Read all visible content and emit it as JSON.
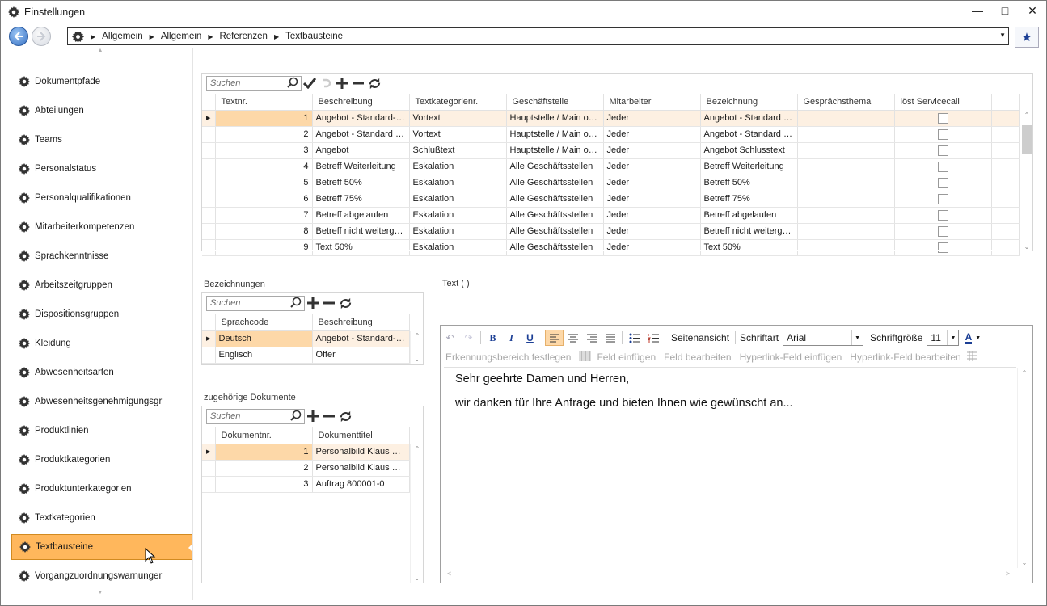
{
  "window": {
    "title": "Einstellungen"
  },
  "breadcrumb": [
    "Allgemein",
    "Allgemein",
    "Referenzen",
    "Textbausteine"
  ],
  "sidebar": {
    "items": [
      "Dokumentpfade",
      "Abteilungen",
      "Teams",
      "Personalstatus",
      "Personalqualifikationen",
      "Mitarbeiterkompetenzen",
      "Sprachkenntnisse",
      "Arbeitszeitgruppen",
      "Dispositionsgruppen",
      "Kleidung",
      "Abwesenheitsarten",
      "Abwesenheitsgenehmigungsgr",
      "Produktlinien",
      "Produktkategorien",
      "Produktunterkategorien",
      "Textkategorien",
      "Textbausteine",
      "Vorgangzuordnungswarnunger"
    ],
    "active": "Textbausteine"
  },
  "main_grid": {
    "search_placeholder": "Suchen",
    "columns": [
      "Textnr.",
      "Beschreibung",
      "Textkategorienr.",
      "Geschäftstelle",
      "Mitarbeiter",
      "Bezeichnung",
      "Gesprächsthema",
      "löst Servicecall"
    ],
    "rows": [
      {
        "nr": "1",
        "beschreibung": "Angebot - Standard-…",
        "kategorie": "Vortext",
        "stelle": "Hauptstelle / Main o…",
        "mitarbeiter": "Jeder",
        "bezeichnung": "Angebot - Standard -…",
        "thema": ""
      },
      {
        "nr": "2",
        "beschreibung": "Angebot - Standard -…",
        "kategorie": "Vortext",
        "stelle": "Hauptstelle / Main o…",
        "mitarbeiter": "Jeder",
        "bezeichnung": "Angebot - Standard -…",
        "thema": ""
      },
      {
        "nr": "3",
        "beschreibung": "Angebot",
        "kategorie": "Schlußtext",
        "stelle": "Hauptstelle / Main o…",
        "mitarbeiter": "Jeder",
        "bezeichnung": "Angebot Schlusstext",
        "thema": ""
      },
      {
        "nr": "4",
        "beschreibung": "Betreff Weiterleitung",
        "kategorie": "Eskalation",
        "stelle": "Alle Geschäftsstellen",
        "mitarbeiter": "Jeder",
        "bezeichnung": "Betreff Weiterleitung",
        "thema": ""
      },
      {
        "nr": "5",
        "beschreibung": "Betreff 50%",
        "kategorie": "Eskalation",
        "stelle": "Alle Geschäftsstellen",
        "mitarbeiter": "Jeder",
        "bezeichnung": "Betreff 50%",
        "thema": ""
      },
      {
        "nr": "6",
        "beschreibung": "Betreff 75%",
        "kategorie": "Eskalation",
        "stelle": "Alle Geschäftsstellen",
        "mitarbeiter": "Jeder",
        "bezeichnung": "Betreff 75%",
        "thema": ""
      },
      {
        "nr": "7",
        "beschreibung": "Betreff abgelaufen",
        "kategorie": "Eskalation",
        "stelle": "Alle Geschäftsstellen",
        "mitarbeiter": "Jeder",
        "bezeichnung": "Betreff abgelaufen",
        "thema": ""
      },
      {
        "nr": "8",
        "beschreibung": "Betreff nicht weiterg…",
        "kategorie": "Eskalation",
        "stelle": "Alle Geschäftsstellen",
        "mitarbeiter": "Jeder",
        "bezeichnung": "Betreff nicht weiterg…",
        "thema": ""
      },
      {
        "nr": "9",
        "beschreibung": "Text 50%",
        "kategorie": "Eskalation",
        "stelle": "Alle Geschäftsstellen",
        "mitarbeiter": "Jeder",
        "bezeichnung": "Text 50%",
        "thema": ""
      }
    ]
  },
  "bezeichnungen": {
    "label": "Bezeichnungen",
    "search_placeholder": "Suchen",
    "columns": [
      "Sprachcode",
      "Beschreibung"
    ],
    "rows": [
      {
        "code": "Deutsch",
        "beschreibung": "Angebot - Standard-S…"
      },
      {
        "code": "Englisch",
        "beschreibung": "Offer"
      }
    ]
  },
  "dokumente": {
    "label": "zugehörige Dokumente",
    "search_placeholder": "Suchen",
    "columns": [
      "Dokumentnr.",
      "Dokumenttitel"
    ],
    "rows": [
      {
        "nr": "1",
        "titel": "Personalbild Klaus Sp…"
      },
      {
        "nr": "2",
        "titel": "Personalbild Klaus Sp…"
      },
      {
        "nr": "3",
        "titel": "Auftrag 800001-0"
      }
    ]
  },
  "text_label": "Text  ( )",
  "editor": {
    "seitenansicht": "Seitenansicht",
    "schriftart_label": "Schriftart",
    "font": "Arial",
    "groesse_label": "Schriftgröße",
    "size": "11",
    "toolbar2": [
      "Erkennungsbereich festlegen",
      "Feld einfügen",
      "Feld bearbeiten",
      "Hyperlink-Feld einfügen",
      "Hyperlink-Feld bearbeiten"
    ],
    "paragraphs": [
      "Sehr geehrte Damen und Herren,",
      "wir danken für Ihre Anfrage und bieten Ihnen wie gewünscht an..."
    ]
  },
  "colors": {
    "accent": "#ffb75c",
    "selected_row": "#fdf0e2",
    "selected_cell": "#fdd8a8",
    "star": "#1c3f95"
  }
}
